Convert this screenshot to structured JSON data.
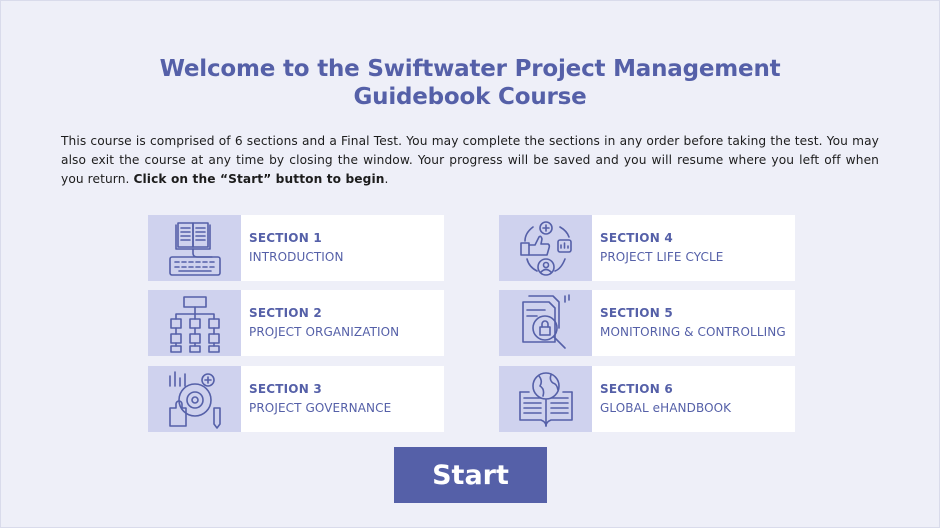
{
  "page": {
    "title_line1": "Welcome to the Swiftwater Project Management",
    "title_line2": "Guidebook Course",
    "intro_text": "This course is comprised of 6 sections and a Final Test. You may complete the sections in any order before taking the test.  You may also exit the course at any time by closing the window.  Your progress will be saved and you will resume where you left off when you return. ",
    "intro_bold": "Click on the “Start” button to begin",
    "intro_end": "."
  },
  "sections": [
    {
      "label": "SECTION 1",
      "name": "INTRODUCTION",
      "icon": "book-keyboard-icon"
    },
    {
      "label": "SECTION 2",
      "name": "PROJECT ORGANIZATION",
      "icon": "org-chart-icon"
    },
    {
      "label": "SECTION 3",
      "name": "PROJECT GOVERNANCE",
      "icon": "governance-gear-icon"
    },
    {
      "label": "SECTION 4",
      "name": "PROJECT LIFE CYCLE",
      "icon": "life-cycle-icon"
    },
    {
      "label": "SECTION 5",
      "name": "MONITORING & CONTROLLING",
      "icon": "document-lock-magnifier-icon"
    },
    {
      "label": "SECTION 6",
      "name": "GLOBAL eHANDBOOK",
      "icon": "globe-book-icon"
    }
  ],
  "start_button": {
    "label": "Start"
  },
  "colors": {
    "accent": "#5560a8",
    "icon_bg": "#cfd2ee",
    "page_bg": "#eeeff8"
  }
}
